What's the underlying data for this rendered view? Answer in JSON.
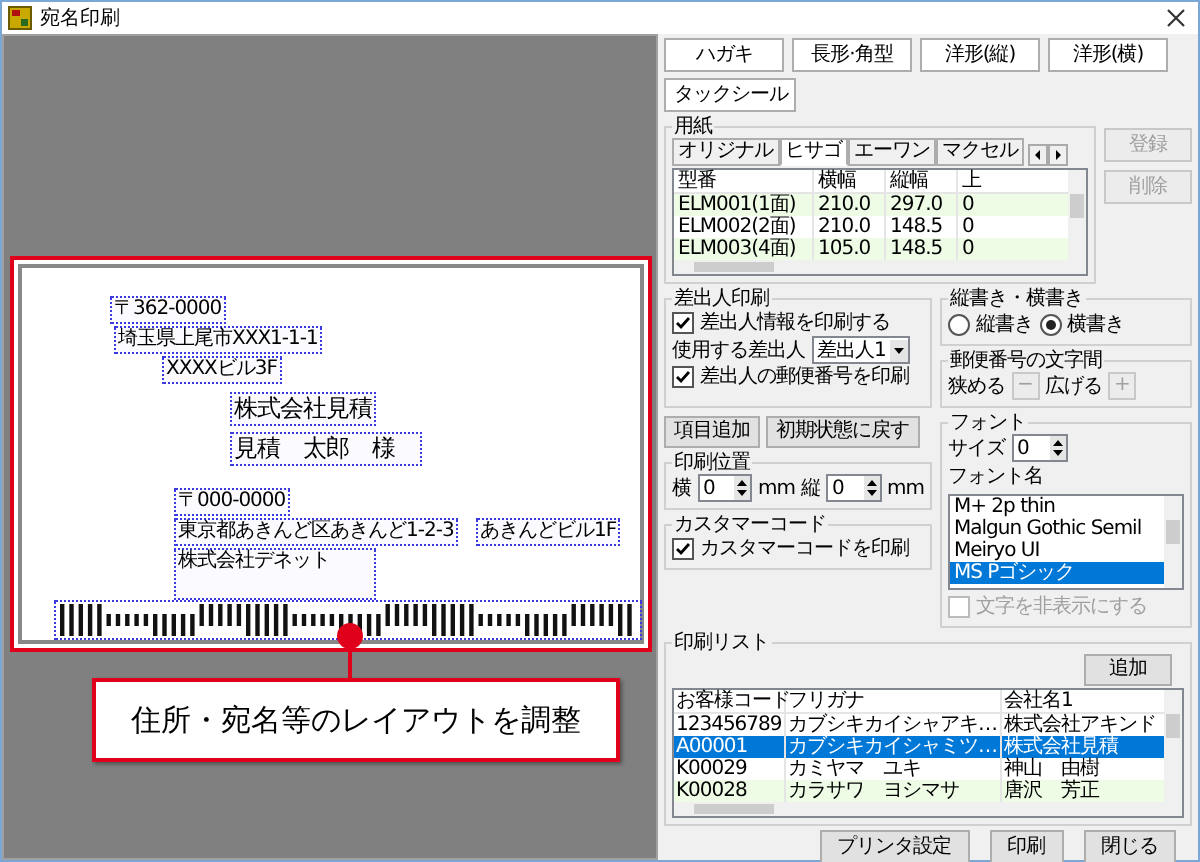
{
  "window": {
    "title": "宛名印刷"
  },
  "preview": {
    "items": [
      {
        "kind": "recipient-postal",
        "text": "〒362-0000"
      },
      {
        "kind": "recipient-address",
        "text": "埼玉県上尾市XXX1-1-1"
      },
      {
        "kind": "recipient-building",
        "text": "XXXXビル3F"
      },
      {
        "kind": "recipient-company",
        "text": "株式会社見積"
      },
      {
        "kind": "recipient-name",
        "text": "見積　太郎　様"
      },
      {
        "kind": "sender-postal",
        "text": "〒000-0000"
      },
      {
        "kind": "sender-address",
        "text": "東京都あきんど区あきんど1-2-3"
      },
      {
        "kind": "sender-building",
        "text": "あきんどビル1F"
      },
      {
        "kind": "sender-company",
        "text": "株式会社デネット"
      }
    ]
  },
  "callout": "住所・宛名等のレイアウトを調整",
  "type_buttons": [
    "ハガキ",
    "長形·角型",
    "洋形(縦)",
    "洋形(横)",
    "タックシール"
  ],
  "paper": {
    "legend": "用紙",
    "tabs": [
      {
        "label": "オリジナル",
        "selected": false
      },
      {
        "label": "ヒサゴ",
        "selected": true
      },
      {
        "label": "エーワン",
        "selected": false
      },
      {
        "label": "マクセル",
        "selected": false
      }
    ],
    "columns": [
      "型番",
      "横幅",
      "縦幅",
      "上"
    ],
    "rows": [
      [
        "ELM001(1面)",
        "210.0",
        "297.0",
        "0"
      ],
      [
        "ELM002(2面)",
        "210.0",
        "148.5",
        "0"
      ],
      [
        "ELM003(4面)",
        "105.0",
        "148.5",
        "0"
      ]
    ],
    "buttons": [
      {
        "label": "登録",
        "disabled": true
      },
      {
        "label": "削除",
        "disabled": true
      }
    ]
  },
  "sender": {
    "legend": "差出人印刷",
    "print_sender": {
      "label": "差出人情報を印刷する",
      "checked": true
    },
    "use_label": "使用する差出人",
    "use_value": "差出人1",
    "print_postal": {
      "label": "差出人の郵便番号を印刷",
      "checked": true
    }
  },
  "orientation": {
    "legend": "縦書き・横書き",
    "options": [
      {
        "label": "縦書き",
        "selected": false
      },
      {
        "label": "横書き",
        "selected": true
      }
    ]
  },
  "postal_spacing": {
    "legend": "郵便番号の文字間",
    "narrow_label": "狭める",
    "narrow_button": {
      "label": "−",
      "disabled": true
    },
    "widen_label": "広げる",
    "widen_button": {
      "label": "+",
      "disabled": true
    }
  },
  "actions": [
    "項目追加",
    "初期状態に戻す"
  ],
  "position": {
    "legend": "印刷位置",
    "x_label": "横",
    "x_value": "0",
    "x_unit": "mm",
    "y_label": "縦",
    "y_value": "0",
    "y_unit": "mm"
  },
  "customer_code": {
    "legend": "カスタマーコード",
    "label": "カスタマーコードを印刷",
    "checked": true
  },
  "font": {
    "legend": "フォント",
    "size_label": "サイズ",
    "size_value": "0",
    "name_label": "フォント名",
    "names": [
      {
        "label": "M+ 2p thin",
        "selected": false
      },
      {
        "label": "Malgun Gothic Semil",
        "selected": false
      },
      {
        "label": "Meiryo UI",
        "selected": false
      },
      {
        "label": "MS Pゴシック",
        "selected": true
      }
    ],
    "hide_text": {
      "label": "文字を非表示にする",
      "checked": false,
      "disabled": true
    }
  },
  "print_list": {
    "legend": "印刷リスト",
    "add_button": "追加",
    "columns": [
      "お客様コード",
      "フリガナ",
      "会社名1"
    ],
    "rows": [
      {
        "cells": [
          "123456789",
          "カブシキカイシャアキ…",
          "株式会社アキンド"
        ],
        "selected": false
      },
      {
        "cells": [
          "A00001",
          "カブシキカイシャミツ…",
          "株式会社見積"
        ],
        "selected": true
      },
      {
        "cells": [
          "K00029",
          "カミヤマ　ユキ",
          "神山　由樹"
        ],
        "selected": false
      },
      {
        "cells": [
          "K00028",
          "カラサワ　ヨシマサ",
          "唐沢　芳正"
        ],
        "selected": false
      }
    ]
  },
  "footer_buttons": [
    "プリンタ設定",
    "印刷",
    "閉じる"
  ]
}
